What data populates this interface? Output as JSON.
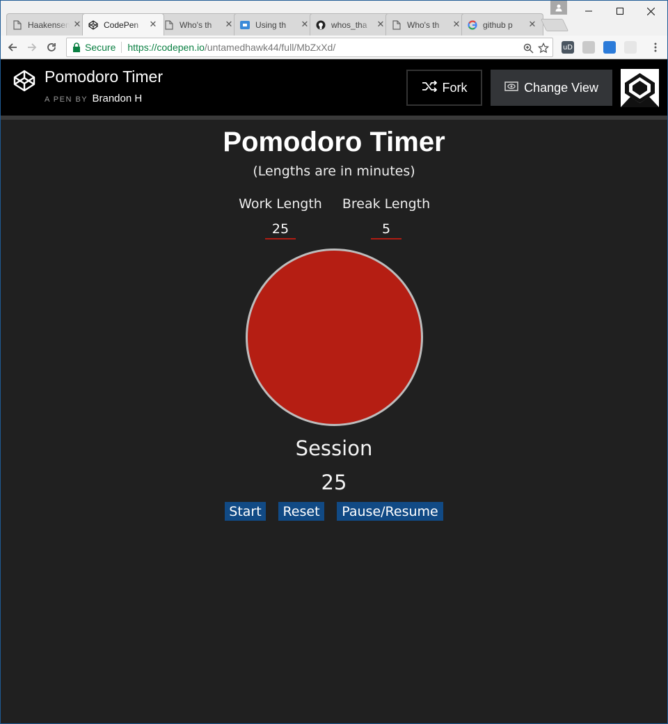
{
  "browser": {
    "tabs": [
      {
        "title": "Haakensen",
        "icon": "document-icon"
      },
      {
        "title": "CodePen",
        "icon": "codepen-icon"
      },
      {
        "title": "Who's th",
        "icon": "document-icon"
      },
      {
        "title": "Using th",
        "icon": "chat-icon"
      },
      {
        "title": "whos_tha",
        "icon": "github-icon"
      },
      {
        "title": "Who's th",
        "icon": "document-icon"
      },
      {
        "title": "github p",
        "icon": "google-icon"
      }
    ],
    "close_glyph": "✕",
    "secure_label": "Secure",
    "url_host": "https://codepen.io",
    "url_path": "/untamedhawk44/full/MbZxXd/"
  },
  "codepen": {
    "pen_title": "Pomodoro Timer",
    "byline": "A PEN BY",
    "author": "Brandon H",
    "fork_label": "Fork",
    "change_view_label": "Change View"
  },
  "app": {
    "title": "Pomodoro Timer",
    "subtitle": "(Lengths are in minutes)",
    "work_label": "Work Length",
    "break_label": "Break Length",
    "work_value": "25",
    "break_value": "5",
    "mode": "Session",
    "remaining": "25",
    "start_label": "Start",
    "reset_label": "Reset",
    "pause_label": "Pause/Resume",
    "colors": {
      "circle": "#b51e13",
      "button": "#114a85",
      "background": "#202020"
    }
  }
}
